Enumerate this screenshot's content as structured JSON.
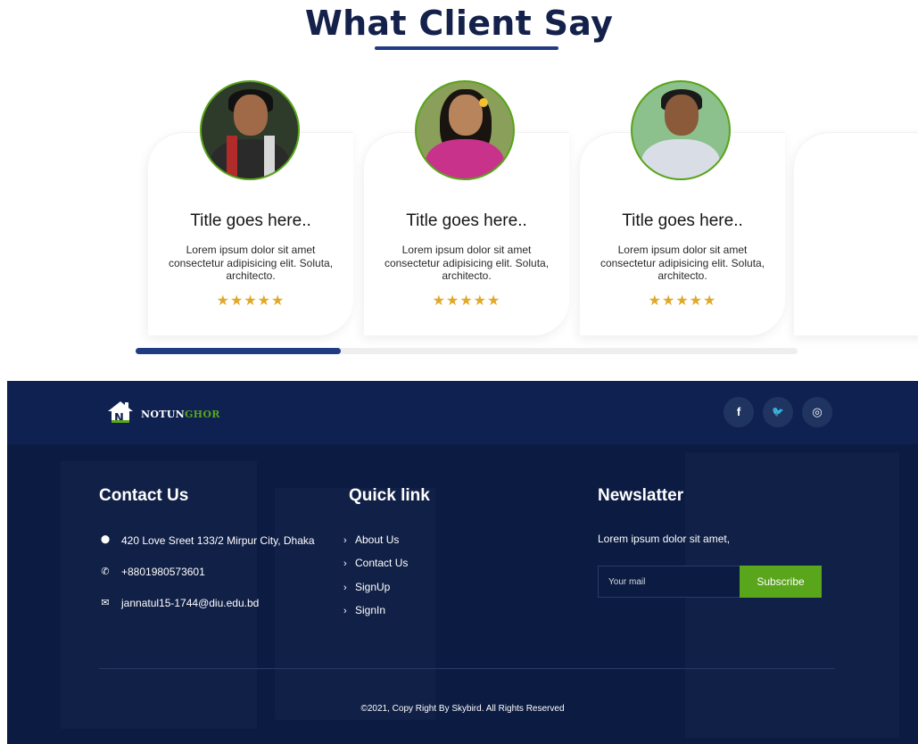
{
  "testimonials": {
    "heading": "What Client Say",
    "cards": [
      {
        "title": "Title goes here..",
        "text": "Lorem ipsum dolor sit amet consectetur adipisicing elit. Soluta, architecto.",
        "stars": "★★★★★",
        "rating": 5
      },
      {
        "title": "Title goes here..",
        "text": "Lorem ipsum dolor sit amet consectetur adipisicing elit. Soluta, architecto.",
        "stars": "★★★★★",
        "rating": 5
      },
      {
        "title": "Title goes here..",
        "text": "Lorem ipsum dolor sit amet consectetur adipisicing elit. Soluta, architecto.",
        "stars": "★★★★★",
        "rating": 5
      }
    ],
    "slider_progress": 0.31
  },
  "footer": {
    "brand": {
      "part1": "NOTUN",
      "part2": "GHOR"
    },
    "social": [
      {
        "icon": "facebook-icon",
        "glyph": "f"
      },
      {
        "icon": "twitter-icon",
        "glyph": "🐦"
      },
      {
        "icon": "instagram-icon",
        "glyph": "◎"
      }
    ],
    "contact": {
      "title": "Contact Us",
      "items": [
        {
          "icon": "location-icon",
          "glyph": "⬤",
          "text": "420 Love Sreet 133/2 Mirpur City, Dhaka"
        },
        {
          "icon": "phone-icon",
          "glyph": "✆",
          "text": "+8801980573601"
        },
        {
          "icon": "mail-icon",
          "glyph": "✉",
          "text": "jannatul15-1744@diu.edu.bd"
        }
      ]
    },
    "quick_links": {
      "title": "Quick link",
      "items": [
        "About Us",
        "Contact Us",
        "SignUp",
        "SignIn"
      ]
    },
    "newsletter": {
      "title": "Newslatter",
      "text": "Lorem ipsum dolor sit amet,",
      "placeholder": "Your mail",
      "button": "Subscribe"
    },
    "copyright": "©2021, Copy Right By Skybird. All Rights Reserved"
  },
  "colors": {
    "navy": "#0c1b42",
    "accent_blue": "#1f3b82",
    "green": "#59a51b",
    "star": "#e0a92a"
  }
}
